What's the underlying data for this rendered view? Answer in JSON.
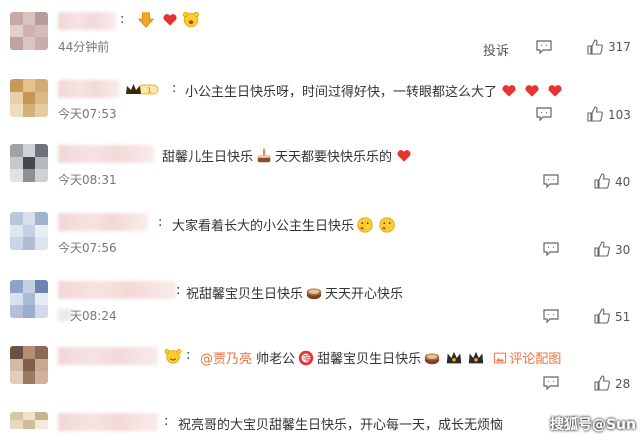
{
  "comments": [
    {
      "text": "",
      "time": "44分钟前",
      "report_label": "投诉",
      "likes": "317"
    },
    {
      "text": "小公主生日快乐呀，时间过得好快，一转眼都这么大了",
      "time": "今天07:53",
      "likes": "103"
    },
    {
      "text_a": "甜馨儿生日快乐",
      "text_b": "天天都要快快乐乐的",
      "time": "今天08:31",
      "likes": "40"
    },
    {
      "text": "大家看着长大的小公主生日快乐",
      "time": "今天07:56",
      "likes": "30"
    },
    {
      "text_a": "祝甜馨宝贝生日快乐",
      "text_b": "天天开心快乐",
      "time": "天08:24",
      "likes": "51"
    },
    {
      "mention": "@贾乃亮",
      "text_a": "帅老公",
      "text_b": "甜馨宝贝生日快乐",
      "link": "评论配图",
      "likes": "28"
    },
    {
      "text": "祝亮哥的大宝贝甜馨生日快乐，开心每一天，成长无烦恼"
    }
  ],
  "watermark": "搜狐号@Sun",
  "colors": {
    "heart": "#e8322f",
    "accent": "#eb7340",
    "muted": "#777777"
  }
}
